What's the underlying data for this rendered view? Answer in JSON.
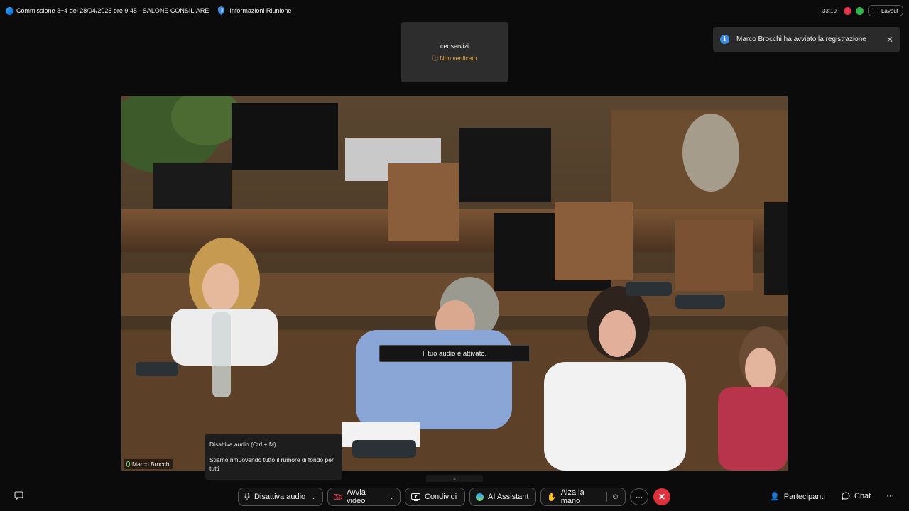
{
  "window": {
    "title": "Commissione 3+4 del 28/04/2025 ore 9:45 - SALONE CONSILIARE",
    "info_label": "Informazioni Riunione",
    "timer": "33:19",
    "layout_label": "Layout"
  },
  "participant_tile": {
    "name": "cedservizi",
    "status": "Non verificato"
  },
  "notification": {
    "text": "Marco Brocchi ha avviato la registrazione"
  },
  "video": {
    "speaker_name": "Marco Brocchi",
    "audio_status": "Il tuo audio è attivato."
  },
  "tooltip": {
    "title": "Disattiva audio  (Ctrl + M)",
    "body": "Stiamo rimuovendo tutto il rumore di fondo per tutti"
  },
  "toolbar": {
    "mute_label": "Disattiva audio",
    "video_label": "Avvia video",
    "share_label": "Condividi",
    "ai_label": "AI Assistant",
    "raise_hand_label": "Alza la mano",
    "participants_label": "Partecipanti",
    "chat_label": "Chat",
    "more_label": "···"
  },
  "colors": {
    "accent_blue": "#3d8be0",
    "end_red": "#e0313f",
    "warning_orange": "#e6a23c",
    "mic_green": "#5ecf6b"
  }
}
